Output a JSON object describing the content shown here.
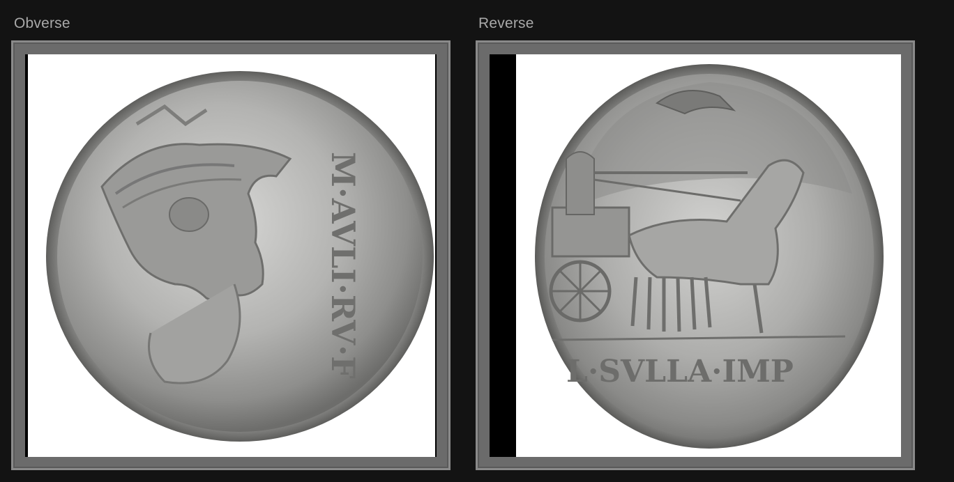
{
  "obverse": {
    "label": "Obverse",
    "legend": "M·AVLI·RV·F",
    "icon": "coin-obverse-image"
  },
  "reverse": {
    "label": "Reverse",
    "legend": "L·SVLLA·IMP",
    "icon": "coin-reverse-image"
  },
  "colors": {
    "page_background": "#131313",
    "frame": "#6b6b6b",
    "label_text": "#a9a9a9",
    "silver": "#b9b9b7"
  }
}
